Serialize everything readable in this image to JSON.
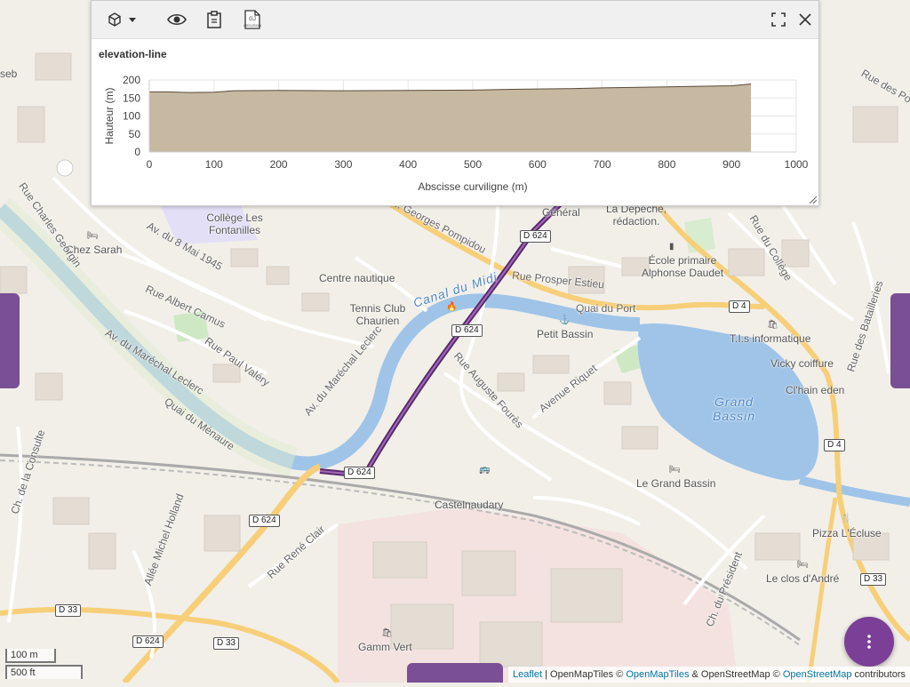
{
  "toolbar": {
    "icons": [
      "cube-icon",
      "dropdown-caret-icon",
      "eye-icon",
      "clipboard-icon",
      "geojson-file-icon",
      "fullscreen-icon",
      "close-icon"
    ],
    "geojson_label": "GEOJSON"
  },
  "chart_data": {
    "type": "area",
    "title": "elevation-line",
    "xlabel": "Abscisse curviligne (m)",
    "ylabel": "Hauteur (m)",
    "xlim": [
      0,
      1000
    ],
    "ylim": [
      0,
      200
    ],
    "xticks": [
      "0",
      "100",
      "200",
      "300",
      "400",
      "500",
      "600",
      "700",
      "800",
      "900",
      "1000"
    ],
    "yticks": [
      "0",
      "50",
      "100",
      "150",
      "200"
    ],
    "x": [
      0,
      30,
      60,
      100,
      130,
      200,
      300,
      400,
      500,
      560,
      650,
      700,
      800,
      900,
      930
    ],
    "y": [
      167,
      167,
      165,
      166,
      170,
      171,
      170,
      171,
      172,
      174,
      176,
      178,
      181,
      184,
      189
    ],
    "fill_color": "#c7b8a2",
    "line_color": "#5a4a3a",
    "grid": true
  },
  "map": {
    "labels": {
      "college": "Collège Les Fontanilles",
      "chez_sarah": "Chez Sarah",
      "centre_nautique": "Centre nautique",
      "tennis": "Tennis Club Chaurien",
      "petit_bassin": "Petit Bassin",
      "grand_bassin": "Grand Bassin",
      "ecole": "École primaire Alphonse Daudet",
      "depeche": "La Depeche, rédaction.",
      "general": "Général",
      "tis": "T.I.s informatique",
      "vicky": "Vicky coiffure",
      "clhain": "Cl'hain eden",
      "le_grand_bassin": "Le Grand Bassin",
      "pizza": "Pizza L'Écluse",
      "clos": "Le clos d'André",
      "castelnaudary": "Castelnaudary",
      "gamm_vert": "Gamm Vert",
      "canal": "Canal du Midi",
      "rue_prosper": "Rue Prosper Estieu",
      "quai_du_port": "Quai du Port",
      "rue_auguste": "Rue Auguste Fourès",
      "avenue_riquet": "Avenue Riquet",
      "rue_albert": "Rue Albert Camus",
      "rue_paul": "Rue Paul Valéry",
      "av_mai": "Av. du 8 Mai 1945",
      "av_marechal": "Av. du Maréchal Leclerc",
      "quai_menaure": "Quai du Ménaure",
      "ch_consulte": "Ch. de la Consulte",
      "allee_michel": "Allée Michel Holland",
      "rue_rene": "Rue René Clair",
      "ch_president": "Ch. du Président",
      "rue_charles": "Rue Charles Georgin",
      "av_georges": "Av. Georges Pompidou",
      "rue_college": "Rue du Collège",
      "rue_batailleries": "Rue des Batailleries",
      "rue_des_po": "Rue des Po",
      "seb": "seb"
    },
    "shields": {
      "d624_a": "D 624",
      "d624_b": "D 624",
      "d624_c": "D 624",
      "d624_d": "D 624",
      "d624_e": "D 624",
      "d4_a": "D 4",
      "d4_b": "D 4",
      "d33_a": "D 33",
      "d33_b": "D 33",
      "d33_c": "D 33"
    },
    "route_color": "#5b2a6e"
  },
  "scale": {
    "metric": "100 m",
    "imperial": "500 ft"
  },
  "attribution": {
    "leaflet": "Leaflet",
    "sep1": " | OpenMapTiles © ",
    "openmaptiles": "OpenMapTiles",
    "sep2": " & OpenStreetMap © ",
    "osm": "OpenStreetMap",
    "suffix": " contributors"
  },
  "fab_icon": "more-vertical-icon"
}
